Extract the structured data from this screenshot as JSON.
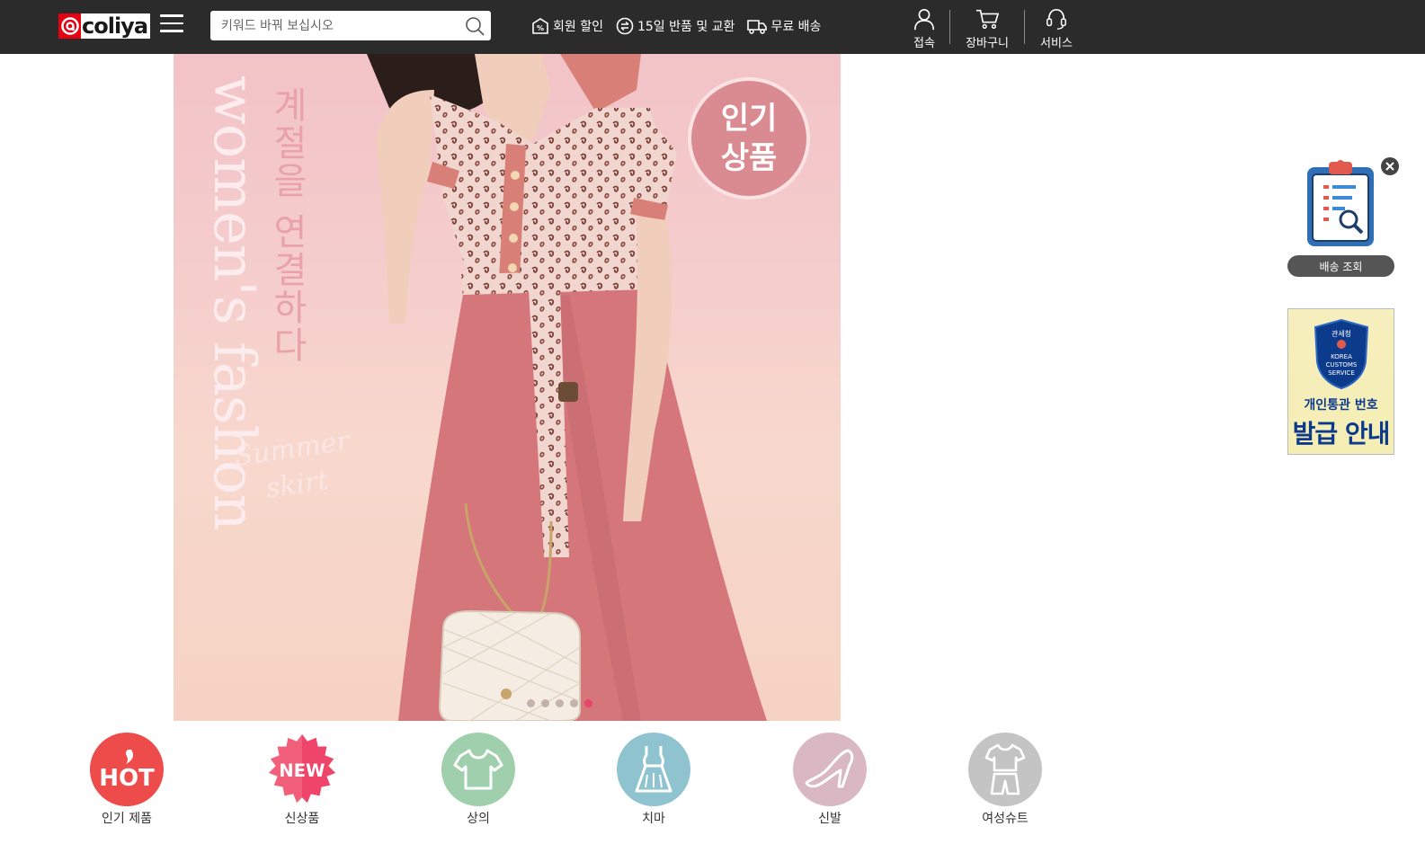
{
  "header": {
    "logo_text": "coliya",
    "logo_mark": "a",
    "search": {
      "placeholder": "키워드 바꿔 보십시오"
    },
    "perks": [
      {
        "icon": "member-discount-icon",
        "label": "회원 할인"
      },
      {
        "icon": "return-exchange-icon",
        "label": "15일 반품 및 교환"
      },
      {
        "icon": "free-shipping-icon",
        "label": "무료 배송"
      }
    ],
    "nav": {
      "login": "접속",
      "cart": "장바구니",
      "service": "서비스"
    }
  },
  "banner": {
    "english_text": "women's fashon",
    "korean_text": "계절을 연결하다",
    "script_line1": "Summer",
    "script_line2": "skirt",
    "badge_line1": "인기",
    "badge_line2": "상품",
    "slide_count": 5,
    "active_slide": 5
  },
  "categories": [
    {
      "label": "인기 제품",
      "badge": "HOT",
      "color": "#ee4b4b"
    },
    {
      "label": "신상품",
      "badge": "NEW",
      "color": "#f25f7a"
    },
    {
      "label": "상의",
      "icon": "tshirt-icon",
      "color": "#9fcfad"
    },
    {
      "label": "치마",
      "icon": "dress-icon",
      "color": "#8fc3cf"
    },
    {
      "label": "신발",
      "icon": "heel-shoe-icon",
      "color": "#d9b8c4"
    },
    {
      "label": "여성슈트",
      "icon": "suit-icon",
      "color": "#c4c4c4"
    }
  ],
  "side": {
    "tracking_label": "배송 조회",
    "customs_seal_line1": "관세청",
    "customs_seal_line2": "KOREA",
    "customs_seal_line3": "CUSTOMS",
    "customs_seal_line4": "SERVICE",
    "customs_line1": "개인통관 번호",
    "customs_line2": "발급 안내"
  },
  "colors": {
    "header_bg": "#2b2b2b",
    "brand_red": "#e60012",
    "dot_active": "#e8446c",
    "customs_blue": "#0d3b8c"
  }
}
